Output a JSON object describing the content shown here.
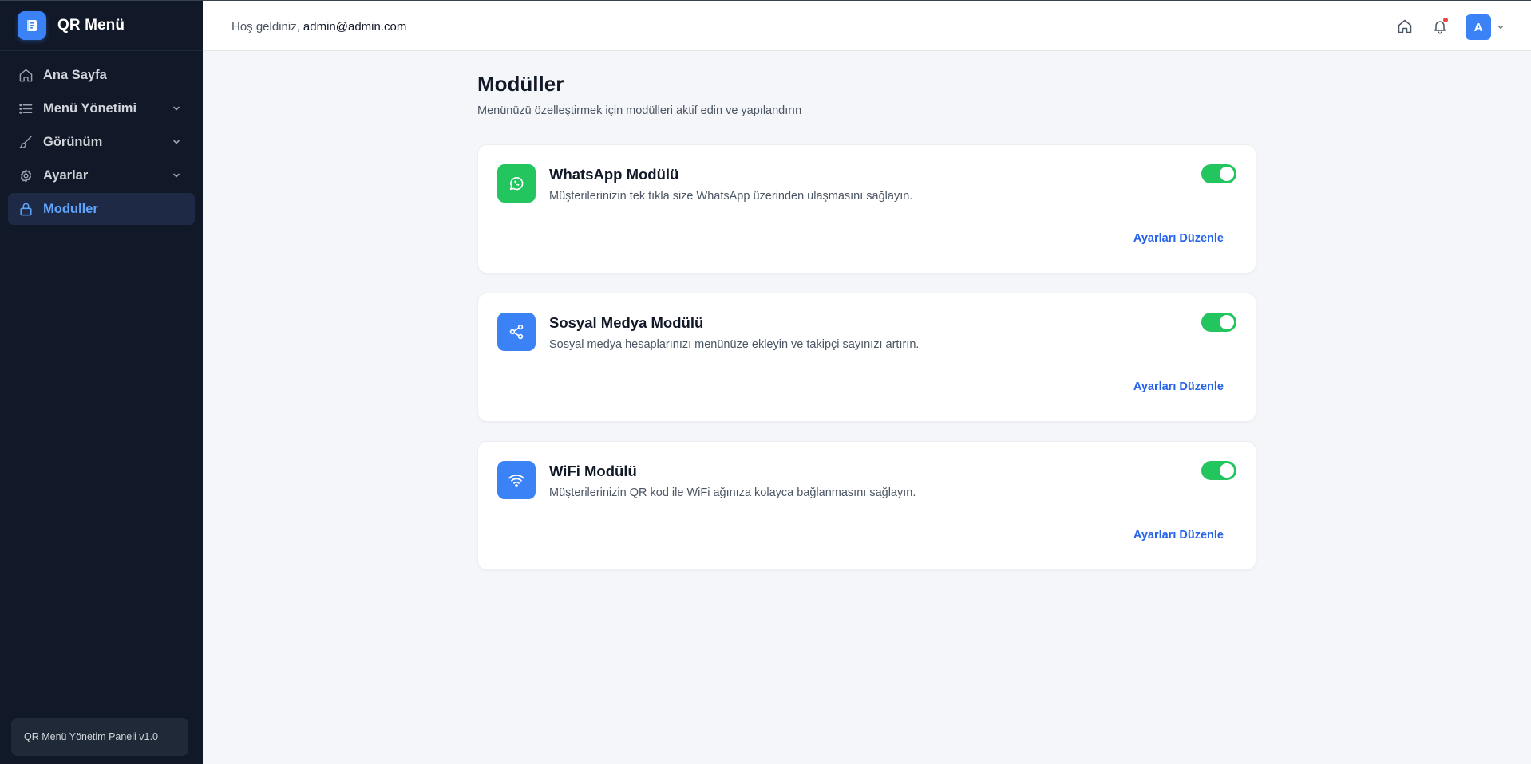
{
  "brand": {
    "title": "QR Menü",
    "icon": "book-icon",
    "accent": "#3b82f6"
  },
  "sidebar": {
    "items": [
      {
        "label": "Ana Sayfa",
        "icon": "home-icon",
        "expandable": false,
        "active": false
      },
      {
        "label": "Menü Yönetimi",
        "icon": "list-icon",
        "expandable": true,
        "active": false
      },
      {
        "label": "Görünüm",
        "icon": "brush-icon",
        "expandable": true,
        "active": false
      },
      {
        "label": "Ayarlar",
        "icon": "gear-icon",
        "expandable": true,
        "active": false
      },
      {
        "label": "Moduller",
        "icon": "lock-icon",
        "expandable": false,
        "active": true
      }
    ],
    "footer": "QR Menü Yönetim Paneli v1.0"
  },
  "topbar": {
    "welcome": "Hoş geldiniz,",
    "email": "admin@admin.com",
    "avatar_letter": "A",
    "has_notification": true
  },
  "page": {
    "title": "Modüller",
    "subtitle": "Menünüzü özelleştirmek için modülleri aktif edin ve yapılandırın"
  },
  "modules": [
    {
      "title": "WhatsApp Modülü",
      "description": "Müşterilerinizin tek tıkla size WhatsApp üzerinden ulaşmasını sağlayın.",
      "enabled": true,
      "link": "Ayarları Düzenle",
      "icon": "whatsapp-icon",
      "color": "#22c55e"
    },
    {
      "title": "Sosyal Medya Modülü",
      "description": "Sosyal medya hesaplarınızı menünüze ekleyin ve takipçi sayınızı artırın.",
      "enabled": true,
      "link": "Ayarları Düzenle",
      "icon": "share-icon",
      "color": "#3b82f6"
    },
    {
      "title": "WiFi Modülü",
      "description": "Müşterilerinizin QR kod ile WiFi ağınıza kolayca bağlanmasını sağlayın.",
      "enabled": true,
      "link": "Ayarları Düzenle",
      "icon": "wifi-icon",
      "color": "#3b82f6"
    }
  ],
  "colors": {
    "toggle_on": "#22c55e",
    "link": "#2563eb",
    "sidebar_bg": "#111827",
    "active": "#60a5fa"
  }
}
